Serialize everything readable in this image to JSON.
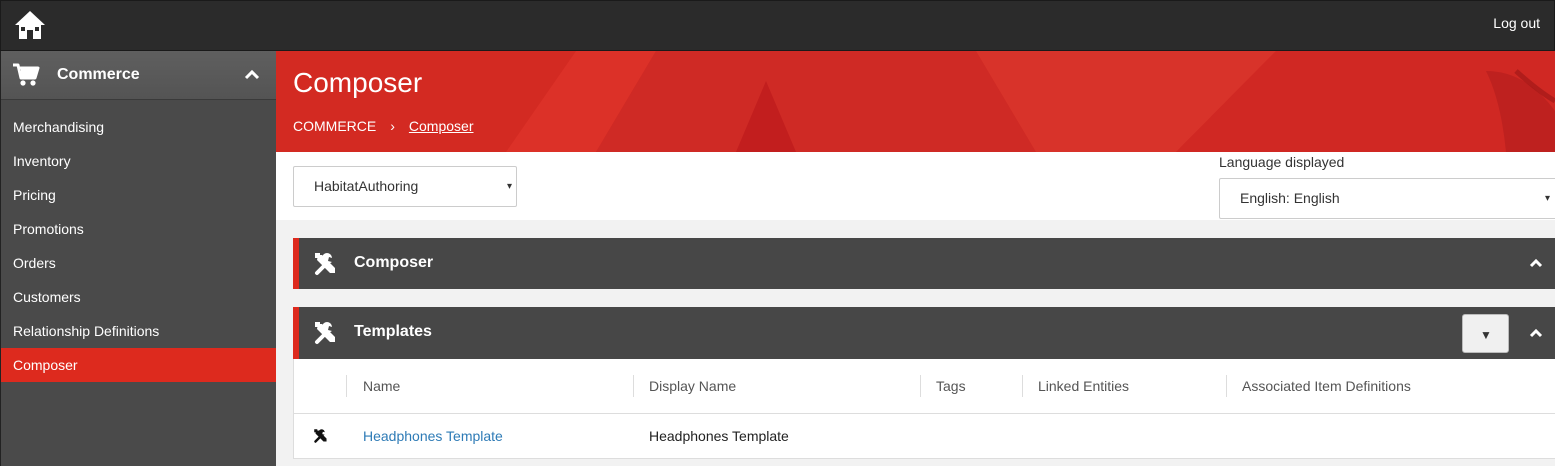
{
  "topbar": {
    "logout_label": "Log out"
  },
  "sidebar": {
    "title": "Commerce",
    "items": [
      {
        "label": "Merchandising",
        "active": false
      },
      {
        "label": "Inventory",
        "active": false
      },
      {
        "label": "Pricing",
        "active": false
      },
      {
        "label": "Promotions",
        "active": false
      },
      {
        "label": "Orders",
        "active": false
      },
      {
        "label": "Customers",
        "active": false
      },
      {
        "label": "Relationship Definitions",
        "active": false
      },
      {
        "label": "Composer",
        "active": true
      }
    ]
  },
  "header": {
    "title": "Composer",
    "breadcrumb": {
      "parent": "COMMERCE",
      "separator": "›",
      "current": "Composer"
    }
  },
  "toolbar": {
    "catalog_select": {
      "value": "HabitatAuthoring",
      "arrow": "▾"
    },
    "language": {
      "label": "Language displayed",
      "value": "English: English",
      "arrow": "▾"
    }
  },
  "panels": {
    "composer": {
      "title": "Composer"
    },
    "templates": {
      "title": "Templates",
      "menu_arrow": "▼",
      "columns": [
        "Name",
        "Display Name",
        "Tags",
        "Linked Entities",
        "Associated Item Definitions"
      ],
      "rows": [
        {
          "name": "Headphones Template",
          "display_name": "Headphones Template",
          "tags": "",
          "linked_entities": "",
          "associated_item_definitions": ""
        }
      ]
    }
  },
  "colors": {
    "accent": "#dd2a1e",
    "topbar": "#2b2b2b",
    "sidebar": "#4a4a4a",
    "panel_header": "#474747",
    "link": "#2e7bb6"
  }
}
